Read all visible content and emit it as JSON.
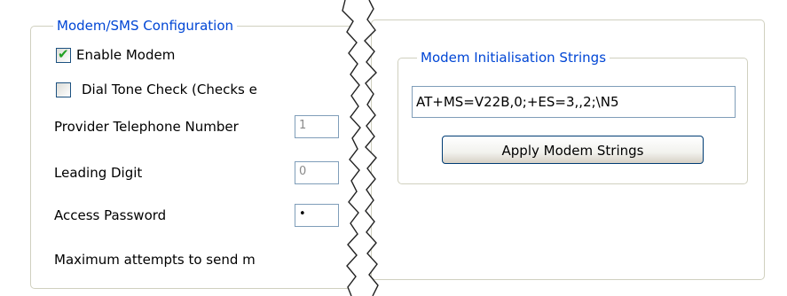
{
  "modem_sms": {
    "legend": "Modem/SMS Configuration",
    "enable_modem": {
      "label": "Enable Modem",
      "checked": true
    },
    "dial_tone_check": {
      "label": "Dial Tone Check (Checks e",
      "checked": false
    },
    "provider_telephone_number": {
      "label": "Provider Telephone Number",
      "value": "1"
    },
    "leading_digit": {
      "label": "Leading Digit",
      "value": "0"
    },
    "access_password": {
      "label": "Access Password",
      "value": "•"
    },
    "max_attempts": {
      "label": "Maximum attempts to send m"
    }
  },
  "modem_init": {
    "legend": "Modem Initialisation Strings",
    "init_string": "AT+MS=V22B,0;+ES=3,,2;\\N5",
    "apply_label": "Apply Modem Strings"
  },
  "colors": {
    "legend_text": "#0046d5",
    "group_border": "#d0d0bf",
    "input_border": "#7f9db9",
    "checkbox_border": "#1c5180",
    "check_mark": "#21a121",
    "button_border": "#003c74"
  },
  "icons": {
    "check": "check-icon"
  }
}
